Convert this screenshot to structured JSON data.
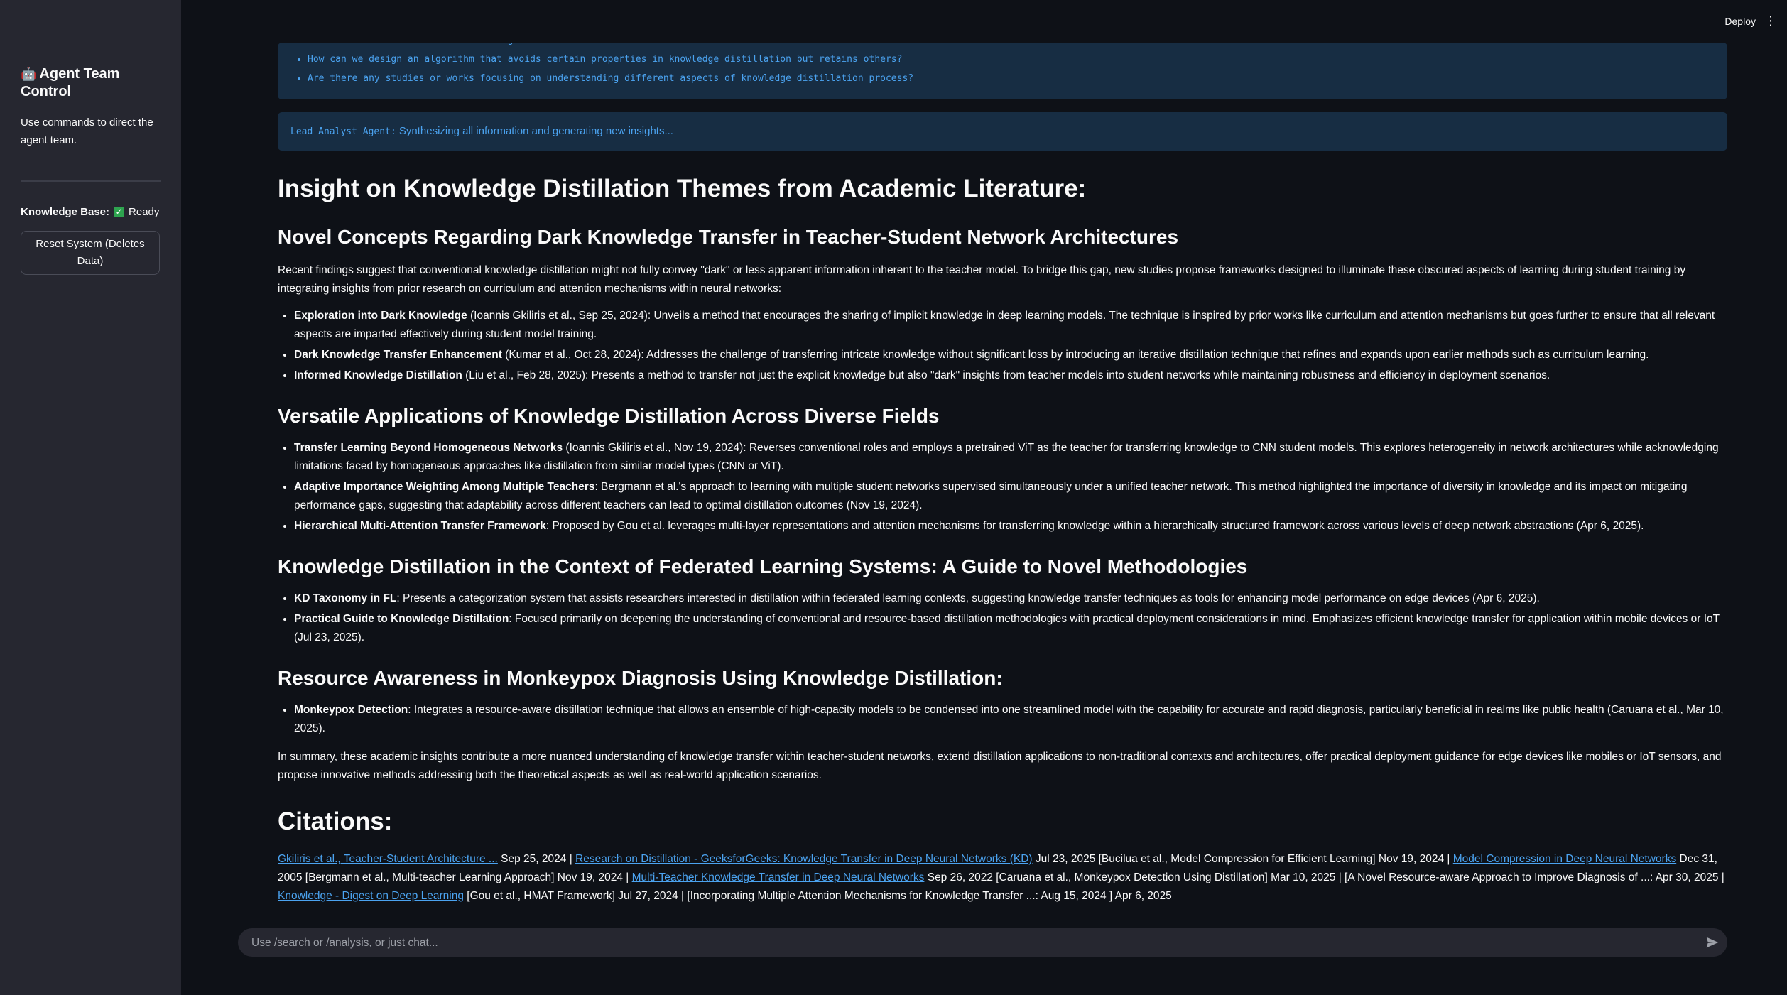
{
  "sidebar": {
    "title_icon": "🤖",
    "title": "Agent Team Control",
    "description": "Use commands to direct the agent team.",
    "kb_label": "Knowledge Base:",
    "kb_check": "✓",
    "kb_status": "Ready",
    "reset_label": "Reset System (Deletes Data)"
  },
  "header": {
    "deploy_label": "Deploy",
    "menu_glyph": "⋮"
  },
  "questions": [
    "What is the current state of knowledge transfer from teacher to student architectures?",
    "How can we design an algorithm that avoids certain properties in knowledge distillation but retains others?",
    "Are there any studies or works focusing on understanding different aspects of knowledge distillation process?"
  ],
  "lead": {
    "agent": "Lead Analyst Agent:",
    "status": "Synthesizing all information and generating new insights..."
  },
  "report": {
    "title": "Insight on Knowledge Distillation Themes from Academic Literature:",
    "sections": [
      {
        "heading": "Novel Concepts Regarding Dark Knowledge Transfer in Teacher-Student Network Architectures",
        "intro": "Recent findings suggest that conventional knowledge distillation might not fully convey \"dark\" or less apparent information inherent to the teacher model. To bridge this gap, new studies propose frameworks designed to illuminate these obscured aspects of learning during student training by integrating insights from prior research on curriculum and attention mechanisms within neural networks:",
        "items": [
          {
            "bold": "Exploration into Dark Knowledge",
            "text": " (Ioannis Gkiliris et al., Sep 25, 2024): Unveils a method that encourages the sharing of implicit knowledge in deep learning models. The technique is inspired by prior works like curriculum and attention mechanisms but goes further to ensure that all relevant aspects are imparted effectively during student model training."
          },
          {
            "bold": "Dark Knowledge Transfer Enhancement",
            "text": " (Kumar et al., Oct 28, 2024): Addresses the challenge of transferring intricate knowledge without significant loss by introducing an iterative distillation technique that refines and expands upon earlier methods such as curriculum learning."
          },
          {
            "bold": "Informed Knowledge Distillation",
            "text": " (Liu et al., Feb 28, 2025): Presents a method to transfer not just the explicit knowledge but also \"dark\" insights from teacher models into student networks while maintaining robustness and efficiency in deployment scenarios."
          }
        ]
      },
      {
        "heading": "Versatile Applications of Knowledge Distillation Across Diverse Fields",
        "intro": "",
        "items": [
          {
            "bold": "Transfer Learning Beyond Homogeneous Networks",
            "text": " (Ioannis Gkiliris et al., Nov 19, 2024): Reverses conventional roles and employs a pretrained ViT as the teacher for transferring knowledge to CNN student models. This explores heterogeneity in network architectures while acknowledging limitations faced by homogeneous approaches like distillation from similar model types (CNN or ViT)."
          },
          {
            "bold": "Adaptive Importance Weighting Among Multiple Teachers",
            "text": ": Bergmann et al.'s approach to learning with multiple student networks supervised simultaneously under a unified teacher network. This method highlighted the importance of diversity in knowledge and its impact on mitigating performance gaps, suggesting that adaptability across different teachers can lead to optimal distillation outcomes (Nov 19, 2024)."
          },
          {
            "bold": "Hierarchical Multi-Attention Transfer Framework",
            "text": ": Proposed by Gou et al. leverages multi-layer representations and attention mechanisms for transferring knowledge within a hierarchically structured framework across various levels of deep network abstractions (Apr 6, 2025)."
          }
        ]
      },
      {
        "heading": "Knowledge Distillation in the Context of Federated Learning Systems: A Guide to Novel Methodologies",
        "intro": "",
        "items": [
          {
            "bold": "KD Taxonomy in FL",
            "text": ": Presents a categorization system that assists researchers interested in distillation within federated learning contexts, suggesting knowledge transfer techniques as tools for enhancing model performance on edge devices (Apr 6, 2025)."
          },
          {
            "bold": "Practical Guide to Knowledge Distillation",
            "text": ": Focused primarily on deepening the understanding of conventional and resource-based distillation methodologies with practical deployment considerations in mind. Emphasizes efficient knowledge transfer for application within mobile devices or IoT (Jul 23, 2025)."
          }
        ]
      },
      {
        "heading": "Resource Awareness in Monkeypox Diagnosis Using Knowledge Distillation:",
        "intro": "",
        "items": [
          {
            "bold": "Monkeypox Detection",
            "text": ": Integrates a resource-aware distillation technique that allows an ensemble of high-capacity models to be condensed into one streamlined model with the capability for accurate and rapid diagnosis, particularly beneficial in realms like public health (Caruana et al., Mar 10, 2025)."
          }
        ]
      }
    ],
    "summary": "In summary, these academic insights contribute a more nuanced understanding of knowledge transfer within teacher-student networks, extend distillation applications to non-traditional contexts and architectures, offer practical deployment guidance for edge devices like mobiles or IoT sensors, and propose innovative methods addressing both the theoretical aspects as well as real-world application scenarios."
  },
  "citations": {
    "title": "Citations:",
    "parts": [
      {
        "link": true,
        "text": "Gkiliris et al., Teacher-Student Architecture ..."
      },
      {
        "link": false,
        "text": " Sep 25, 2024 | "
      },
      {
        "link": true,
        "text": "Research on Distillation - GeeksforGeeks: Knowledge Transfer in Deep Neural Networks (KD)"
      },
      {
        "link": false,
        "text": " Jul 23, 2025 [Bucilua et al., Model Compression for Efficient Learning] Nov 19, 2024 | "
      },
      {
        "link": true,
        "text": "Model Compression in Deep Neural Networks"
      },
      {
        "link": false,
        "text": " Dec 31, 2005 [Bergmann et al., Multi-teacher Learning Approach] Nov 19, 2024 | "
      },
      {
        "link": true,
        "text": "Multi-Teacher Knowledge Transfer in Deep Neural Networks"
      },
      {
        "link": false,
        "text": " Sep 26, 2022 [Caruana et al., Monkeypox Detection Using Distillation] Mar 10, 2025 | [A Novel Resource-aware Approach to Improve Diagnosis of ...: Apr 30, 2025 | "
      },
      {
        "link": true,
        "text": "Knowledge - Digest on Deep Learning"
      },
      {
        "link": false,
        "text": " [Gou et al., HMAT Framework] Jul 27, 2024 | [Incorporating Multiple Attention Mechanisms for Knowledge Transfer ...: Aug 15, 2024 ] Apr 6, 2025"
      }
    ]
  },
  "chat": {
    "placeholder": "Use /search or /analysis, or just chat...",
    "send_icon": "send-icon"
  },
  "colors": {
    "background": "#0e1117",
    "sidebar": "#262730",
    "info_bg": "#172d43",
    "info_text": "#4ba3f0",
    "link": "#4ba3f0"
  }
}
